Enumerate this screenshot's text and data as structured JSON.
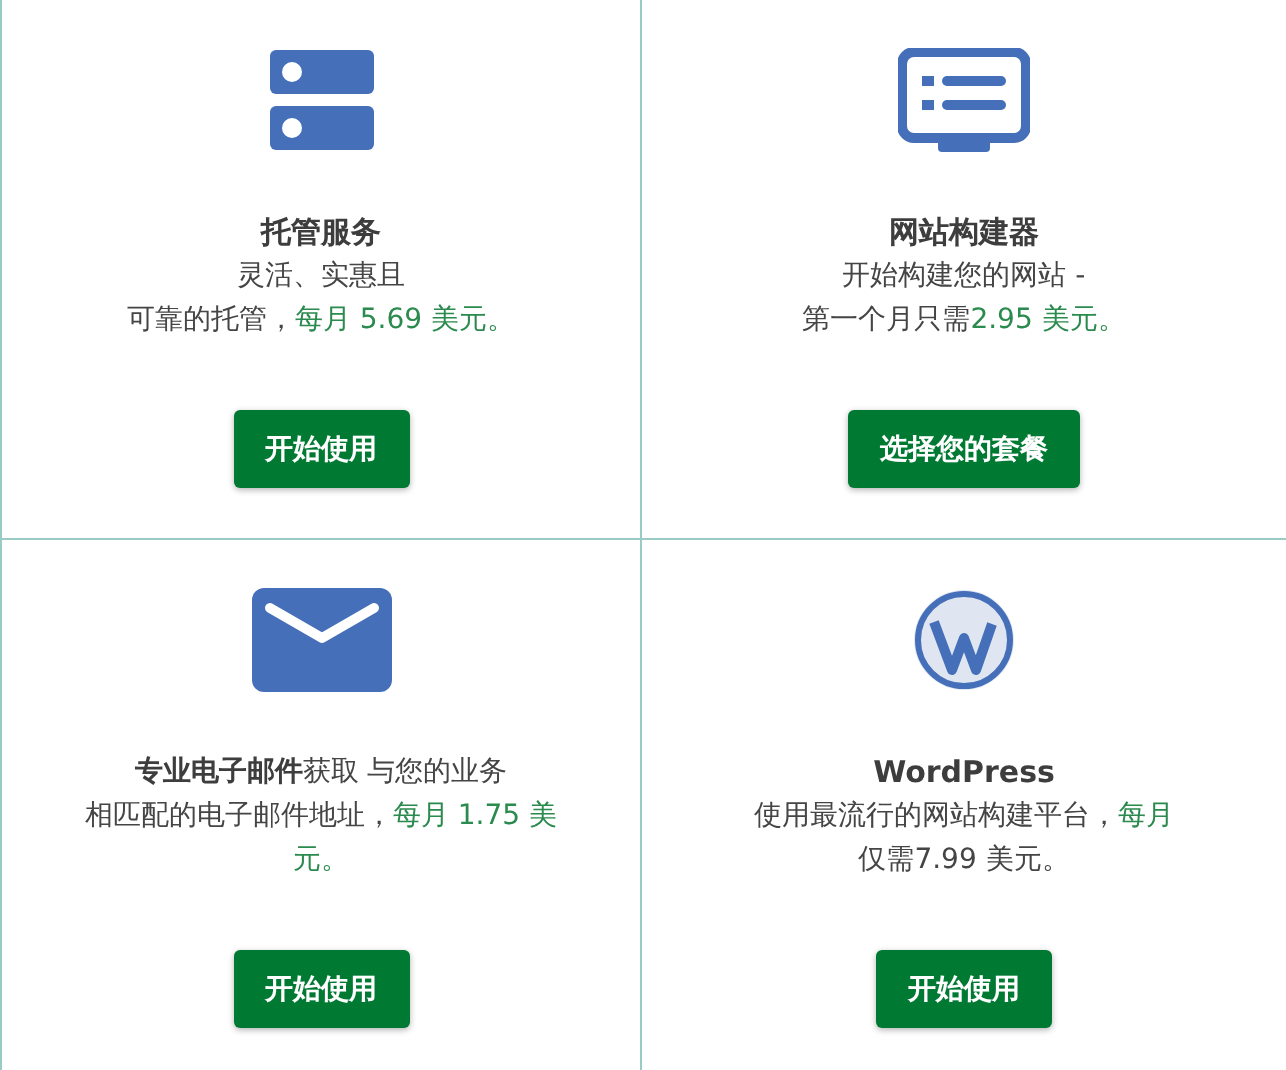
{
  "cards": [
    {
      "kind": "server",
      "title": "托管服务",
      "lines": [
        [
          {
            "text": "灵活、实惠且",
            "highlighted": false
          }
        ],
        [
          {
            "text": "可靠的托管，",
            "highlighted": false
          },
          {
            "text": "每月 5.69 美元。",
            "highlighted": true
          }
        ]
      ],
      "button": "开始使用"
    },
    {
      "kind": "monitor",
      "title": "网站构建器",
      "lines": [
        [
          {
            "text": "开始构建您的网站 -",
            "highlighted": false
          }
        ],
        [
          {
            "text": "第一个月只需",
            "highlighted": false
          },
          {
            "text": "2.95 美元。",
            "highlighted": true
          }
        ]
      ],
      "button": "选择您的套餐"
    },
    {
      "kind": "envelope",
      "lines": [
        [
          {
            "text": "**专业电子邮件**获取 与您的业务",
            "highlighted": false
          }
        ],
        [
          {
            "text": "相匹配的电子邮件地址，",
            "highlighted": false
          },
          {
            "text": "每月 1.75 美",
            "highlighted": true
          }
        ],
        [
          {
            "text": "元。",
            "highlighted": true
          }
        ]
      ],
      "button": "开始使用"
    },
    {
      "kind": "wordpress",
      "title": "WordPress",
      "lines": [
        [
          {
            "text": "使用最流行的网站构建平台，",
            "highlighted": false
          },
          {
            "text": "每月",
            "highlighted": true
          }
        ],
        [
          {
            "text": "仅需7.99 美元。",
            "highlighted": false
          }
        ]
      ],
      "button": "开始使用"
    }
  ]
}
